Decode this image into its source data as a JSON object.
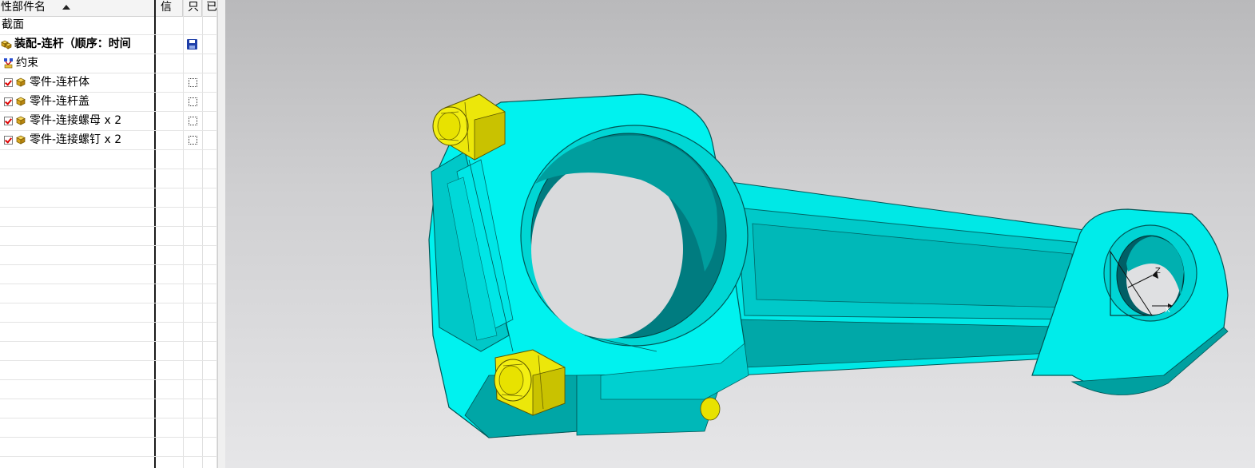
{
  "tree": {
    "columns": {
      "name": "性部件名",
      "info": "信",
      "only": "只",
      "modified": "已"
    },
    "rows": [
      {
        "label": "截面"
      },
      {
        "label": "装配-连杆（顺序：时间"
      },
      {
        "label": "约束"
      },
      {
        "label": "零件-连杆体"
      },
      {
        "label": "零件-连杆盖"
      },
      {
        "label": "零件-连接螺母 x 2"
      },
      {
        "label": "零件-连接螺钉 x 2"
      }
    ]
  },
  "icons": {
    "sort": "sort-ascending-icon",
    "assembly": "assembly-icon",
    "constraints": "constraints-icon",
    "part": "part-cube-icon",
    "check": "checkbox-checked-icon",
    "save": "save-disk-icon",
    "dotted": "dotted-box-icon"
  },
  "colors": {
    "part_cyan": "#00f5f0",
    "part_shadow": "#00a8a8",
    "bolt_yellow": "#f2ee0a",
    "checkbox_red": "#dd0000",
    "viewport_top": "#b9b9bb",
    "viewport_bottom": "#e6e6e8"
  },
  "viewport": {
    "axis_labels": [
      "Z",
      "X"
    ]
  }
}
